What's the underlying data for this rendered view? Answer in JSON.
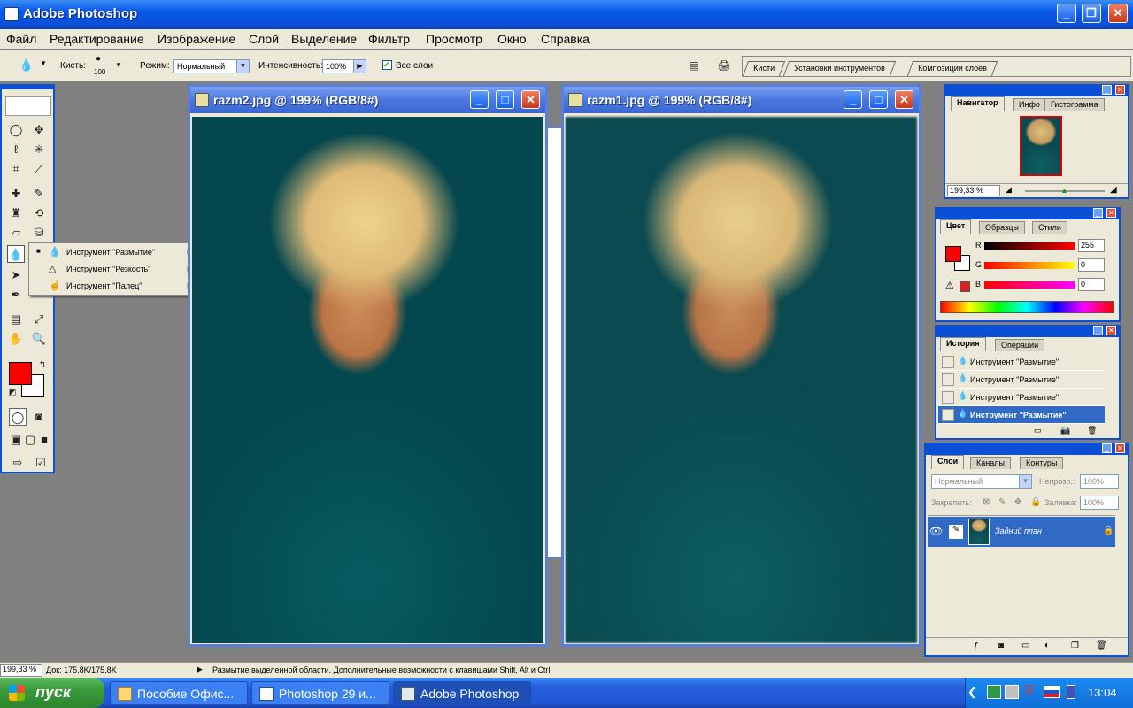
{
  "app": {
    "title": "Adobe Photoshop"
  },
  "menu": [
    "Файл",
    "Редактирование",
    "Изображение",
    "Слой",
    "Выделение",
    "Фильтр",
    "Просмотр",
    "Окно",
    "Справка"
  ],
  "options": {
    "brush_label": "Кисть:",
    "brush_size": "100",
    "mode_label": "Режим:",
    "mode_value": "Нормальный",
    "intensity_label": "Интенсивность:",
    "intensity_value": "100%",
    "all_layers_label": "Все слои",
    "all_layers_checked": true
  },
  "palette_well": {
    "tabs": [
      "Кисти",
      "Установки инструментов",
      "Композиции слоев"
    ]
  },
  "flyout": {
    "items": [
      {
        "label": "Инструмент \"Размытие\"",
        "key": "R",
        "selected": true
      },
      {
        "label": "Инструмент \"Резкость\"",
        "key": "R",
        "selected": false
      },
      {
        "label": "Инструмент \"Палец\"",
        "key": "R",
        "selected": false
      }
    ]
  },
  "documents": [
    {
      "title": "razm2.jpg @ 199% (RGB/8#)"
    },
    {
      "title": "razm1.jpg @ 199% (RGB/8#)"
    }
  ],
  "navigator": {
    "tabs": [
      "Навигатор",
      "Инфо",
      "Гистограмма"
    ],
    "zoom": "199,33 %"
  },
  "color_panel": {
    "tabs": [
      "Цвет",
      "Образцы",
      "Стили"
    ],
    "r_label": "R",
    "g_label": "G",
    "b_label": "B",
    "r": "255",
    "g": "0",
    "b": "0",
    "foreground": "#ff0000"
  },
  "history": {
    "tabs": [
      "История",
      "Операции"
    ],
    "items": [
      "Инструмент \"Размытие\"",
      "Инструмент \"Размытие\"",
      "Инструмент \"Размытие\"",
      "Инструмент \"Размытие\""
    ]
  },
  "layers": {
    "tabs": [
      "Слои",
      "Каналы",
      "Контуры"
    ],
    "blend_mode": "Нормальный",
    "opacity_label": "Непрозр.:",
    "opacity": "100%",
    "lock_label": "Закрепить:",
    "fill_label": "Заливка:",
    "fill": "100%",
    "layer_name": "Задний план"
  },
  "status": {
    "zoom": "199,33 %",
    "doc": "Док: 175,8K/175,8K",
    "hint": "Размытие выделенной области. Дополнительные возможности с клавишами Shift, Alt и Ctrl."
  },
  "taskbar": {
    "start": "пуск",
    "tasks": [
      "Пособие Офис...",
      "Photoshop 29 и...",
      "Adobe Photoshop"
    ],
    "clock": "13:04"
  }
}
